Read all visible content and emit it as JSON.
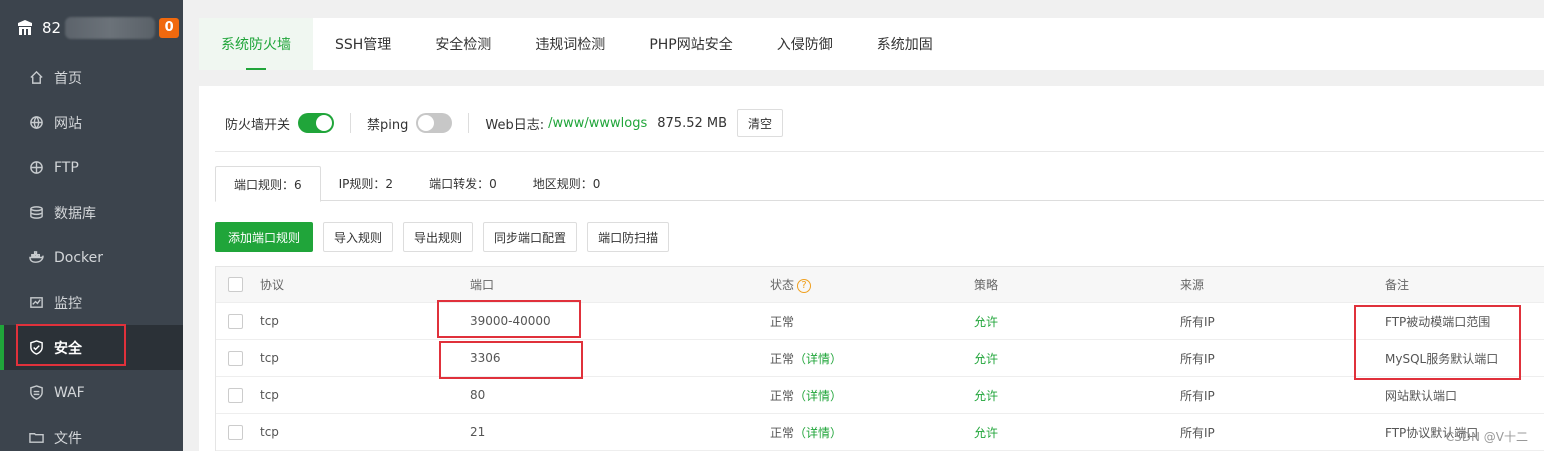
{
  "sidebar": {
    "server_ip_prefix": "82",
    "badge": "0",
    "items": [
      {
        "label": "首页",
        "icon": "home-icon"
      },
      {
        "label": "网站",
        "icon": "globe-icon"
      },
      {
        "label": "FTP",
        "icon": "ftp-icon"
      },
      {
        "label": "数据库",
        "icon": "database-icon"
      },
      {
        "label": "Docker",
        "icon": "docker-icon"
      },
      {
        "label": "监控",
        "icon": "monitor-icon"
      },
      {
        "label": "安全",
        "icon": "shield-icon",
        "active": true
      },
      {
        "label": "WAF",
        "icon": "waf-shield-icon"
      },
      {
        "label": "文件",
        "icon": "folder-icon"
      }
    ]
  },
  "top_tabs": [
    "系统防火墙",
    "SSH管理",
    "安全检测",
    "违规词检测",
    "PHP网站安全",
    "入侵防御",
    "系统加固"
  ],
  "toolbar": {
    "firewall_label": "防火墙开关",
    "firewall_on": true,
    "ping_label": "禁ping",
    "ping_on": false,
    "weblog_label": "Web日志:",
    "weblog_path": "/www/wwwlogs",
    "weblog_size": "875.52 MB",
    "clear_label": "清空"
  },
  "sub_tabs": [
    "端口规则：6",
    "IP规则：2",
    "端口转发：0",
    "地区规则：0"
  ],
  "actions": {
    "add": "添加端口规则",
    "import": "导入规则",
    "export": "导出规则",
    "sync": "同步端口配置",
    "antiscan": "端口防扫描"
  },
  "table": {
    "headers": {
      "protocol": "协议",
      "port": "端口",
      "status": "状态",
      "policy": "策略",
      "source": "来源",
      "note": "备注"
    },
    "rows": [
      {
        "protocol": "tcp",
        "port": "39000-40000",
        "status": "正常",
        "detail": "",
        "policy": "允许",
        "source": "所有IP",
        "note": "FTP被动模端口范围"
      },
      {
        "protocol": "tcp",
        "port": "3306",
        "status": "正常",
        "detail": "（详情）",
        "policy": "允许",
        "source": "所有IP",
        "note": "MySQL服务默认端口"
      },
      {
        "protocol": "tcp",
        "port": "80",
        "status": "正常",
        "detail": "（详情）",
        "policy": "允许",
        "source": "所有IP",
        "note": "网站默认端口"
      },
      {
        "protocol": "tcp",
        "port": "21",
        "status": "正常",
        "detail": "（详情）",
        "policy": "允许",
        "source": "所有IP",
        "note": "FTP协议默认端口"
      }
    ]
  },
  "watermark": "CSDN @V十二",
  "colors": {
    "accent": "#20a53a",
    "sidebar_bg": "#3c444d",
    "highlight": "#e0313b"
  }
}
